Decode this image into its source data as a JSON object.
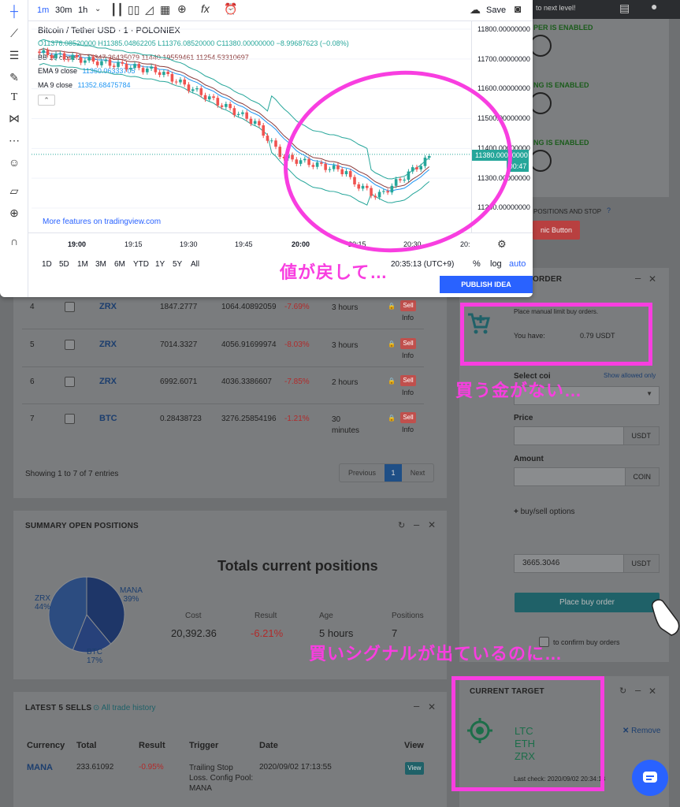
{
  "top_right": {
    "next_level": "to next level!",
    "enabled1": "PER IS ENABLED",
    "enabled2": "NG IS ENABLED",
    "enabled3": "NG IS ENABLED",
    "positions_stop": "POSITIONS AND STOP",
    "panic": "nic Button"
  },
  "chart": {
    "intervals": [
      "1m",
      "30m",
      "1h"
    ],
    "save": "Save",
    "symbol": "Bitcoin / Tether USD · 1 · POLONIEX",
    "ohlc": "O11376.08520000 H11385.04862205 L11376.08520000 C11380.00000000 −8.99687623 (−0.08%)",
    "bb": "BB 20 close 2",
    "bb_vals": "11347.36435079 11440.19559461 11254.53310697",
    "ema": "EMA 9 close",
    "ema_val": "11360.06333705",
    "ma": "MA 9 close",
    "ma_val": "11352.68475784",
    "more": "More features on tradingview.com",
    "price_labels": [
      "11800.00000000",
      "11700.00000000",
      "11600.00000000",
      "11500.00000000",
      "11400.00000000",
      "11300.00000000",
      "11200.00000000"
    ],
    "current_price": "11380.00000000",
    "countdown": "00:47",
    "time_labels": [
      "19:00",
      "19:15",
      "19:30",
      "19:45",
      "20:00",
      "20:15",
      "20:30",
      "20:"
    ],
    "ranges": [
      "1D",
      "5D",
      "1M",
      "3M",
      "6M",
      "YTD",
      "1Y",
      "5Y",
      "All"
    ],
    "clock": "20:35:13 (UTC+9)",
    "pct": "%",
    "log": "log",
    "auto": "auto",
    "publish": "PUBLISH IDEA"
  },
  "positions_table": {
    "rows": [
      {
        "n": "4",
        "coin": "ZRX",
        "amt": "1847.2777",
        "val": "1064.40892059",
        "pct": "-7.69%",
        "age": "3 hours"
      },
      {
        "n": "5",
        "coin": "ZRX",
        "amt": "7014.3327",
        "val": "4056.91699974",
        "pct": "-8.03%",
        "age": "3 hours"
      },
      {
        "n": "6",
        "coin": "ZRX",
        "amt": "6992.6071",
        "val": "4036.3386607",
        "pct": "-7.85%",
        "age": "2 hours"
      },
      {
        "n": "7",
        "coin": "BTC",
        "amt": "0.28438723",
        "val": "3276.25854196",
        "pct": "-1.21%",
        "age": "30 minutes"
      }
    ],
    "sell": "Sell",
    "info": "Info",
    "showing": "Showing 1 to 7 of 7 entries",
    "prev": "Previous",
    "page": "1",
    "next": "Next"
  },
  "summary": {
    "title": "SUMMARY OPEN POSITIONS",
    "heading": "Totals current positions",
    "labels": [
      "Cost",
      "Result",
      "Age",
      "Positions"
    ],
    "values": [
      "20,392.36",
      "-6.21%",
      "5 hours",
      "7"
    ],
    "pie": [
      {
        "name": "ZRX",
        "pct": "44%",
        "value": 44,
        "color": "#2c4c80"
      },
      {
        "name": "MANA",
        "pct": "39%",
        "value": 39,
        "color": "#1e3668"
      },
      {
        "name": "BTC",
        "pct": "17%",
        "value": 17,
        "color": "#27417a"
      }
    ]
  },
  "sells": {
    "title": "LATEST 5 SELLS",
    "history": "All trade history",
    "cols": [
      "Currency",
      "Total",
      "Result",
      "Trigger",
      "Date",
      "View"
    ],
    "row": {
      "coin": "MANA",
      "total": "233.61092",
      "result": "-0.95%",
      "trigger": "Trailing Stop Loss. Config Pool: MANA",
      "date": "2020/09/02 17:13:55",
      "view": "View"
    }
  },
  "order": {
    "title": "ORDER",
    "note": "Place manual limit buy orders.",
    "have_label": "You have:",
    "have_val": "0.79 USDT",
    "select": "Select coi",
    "show_allowed": "Show allowed only",
    "price": "Price",
    "amount": "Amount",
    "usdt": "USDT",
    "coin": "COIN",
    "options": "buy/sell options",
    "total": "3665.3046",
    "place": "Place buy order",
    "confirm": "to confirm buy orders"
  },
  "target": {
    "title": "CURRENT TARGET",
    "coins": [
      "LTC",
      "ETH",
      "ZRX"
    ],
    "remove": "Remove",
    "last": "Last check: 2020/09/02 20:34:13"
  },
  "annotations": {
    "a1": "値が戻して…",
    "a2": "買う金がない…",
    "a3": "買いシグナルが出ているのに…"
  },
  "colors": {
    "pink": "#f83ee0",
    "teal": "#2a6f73",
    "blue": "#2962ff"
  }
}
